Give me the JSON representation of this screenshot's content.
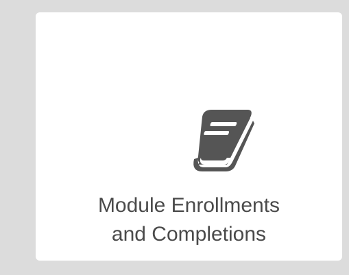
{
  "tile": {
    "icon": "book-icon",
    "label_line1": "Module Enrollments",
    "label_line2": "and Completions"
  },
  "colors": {
    "background": "#dcdcdc",
    "tile": "#ffffff",
    "icon": "#555555",
    "text": "#4a4a4a"
  }
}
